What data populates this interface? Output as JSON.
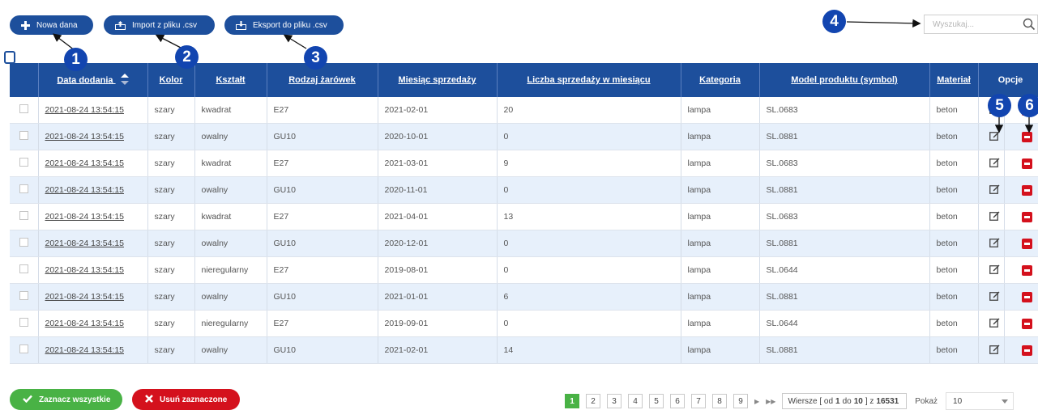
{
  "toolbar": {
    "new_label": "Nowa dana",
    "import_label": "Import z pliku .csv",
    "export_label": "Eksport do pliku .csv"
  },
  "search": {
    "placeholder": "Wyszukaj..."
  },
  "markers": [
    "1",
    "2",
    "3",
    "4",
    "5",
    "6"
  ],
  "table": {
    "headers": [
      "Data dodania",
      "Kolor",
      "Kształt",
      "Rodzaj żarówek",
      "Miesiąc sprzedaży",
      "Liczba sprzedaży w miesiącu",
      "Kategoria",
      "Model produktu (symbol)",
      "Materiał",
      "Opcje"
    ],
    "rows": [
      [
        "2021-08-24 13:54:15",
        "szary",
        "kwadrat",
        "E27",
        "2021-02-01",
        "20",
        "lampa",
        "SL.0683",
        "beton"
      ],
      [
        "2021-08-24 13:54:15",
        "szary",
        "owalny",
        "GU10",
        "2020-10-01",
        "0",
        "lampa",
        "SL.0881",
        "beton"
      ],
      [
        "2021-08-24 13:54:15",
        "szary",
        "kwadrat",
        "E27",
        "2021-03-01",
        "9",
        "lampa",
        "SL.0683",
        "beton"
      ],
      [
        "2021-08-24 13:54:15",
        "szary",
        "owalny",
        "GU10",
        "2020-11-01",
        "0",
        "lampa",
        "SL.0881",
        "beton"
      ],
      [
        "2021-08-24 13:54:15",
        "szary",
        "kwadrat",
        "E27",
        "2021-04-01",
        "13",
        "lampa",
        "SL.0683",
        "beton"
      ],
      [
        "2021-08-24 13:54:15",
        "szary",
        "owalny",
        "GU10",
        "2020-12-01",
        "0",
        "lampa",
        "SL.0881",
        "beton"
      ],
      [
        "2021-08-24 13:54:15",
        "szary",
        "nieregularny",
        "E27",
        "2019-08-01",
        "0",
        "lampa",
        "SL.0644",
        "beton"
      ],
      [
        "2021-08-24 13:54:15",
        "szary",
        "owalny",
        "GU10",
        "2021-01-01",
        "6",
        "lampa",
        "SL.0881",
        "beton"
      ],
      [
        "2021-08-24 13:54:15",
        "szary",
        "nieregularny",
        "E27",
        "2019-09-01",
        "0",
        "lampa",
        "SL.0644",
        "beton"
      ],
      [
        "2021-08-24 13:54:15",
        "szary",
        "owalny",
        "GU10",
        "2021-02-01",
        "14",
        "lampa",
        "SL.0881",
        "beton"
      ]
    ]
  },
  "footer": {
    "select_all_label": "Zaznacz wszystkie",
    "delete_selected_label": "Usuń zaznaczone",
    "pages": [
      "1",
      "2",
      "3",
      "4",
      "5",
      "6",
      "7",
      "8",
      "9"
    ],
    "rows_prefix": "Wiersze [ od",
    "rows_from": "1",
    "rows_mid": "do",
    "rows_to": "10",
    "rows_of": "] z",
    "rows_total": "16531",
    "show_label": "Pokaż",
    "page_size": "10"
  },
  "colors": {
    "primary": "#1d4f9c",
    "green": "#49b245",
    "red": "#d4111d",
    "row_alt": "#e7f0fb"
  },
  "icons": [
    "plus-icon",
    "upload-icon",
    "download-icon",
    "search-icon",
    "sort-icon",
    "edit-icon",
    "delete-icon",
    "check-icon",
    "x-icon"
  ]
}
